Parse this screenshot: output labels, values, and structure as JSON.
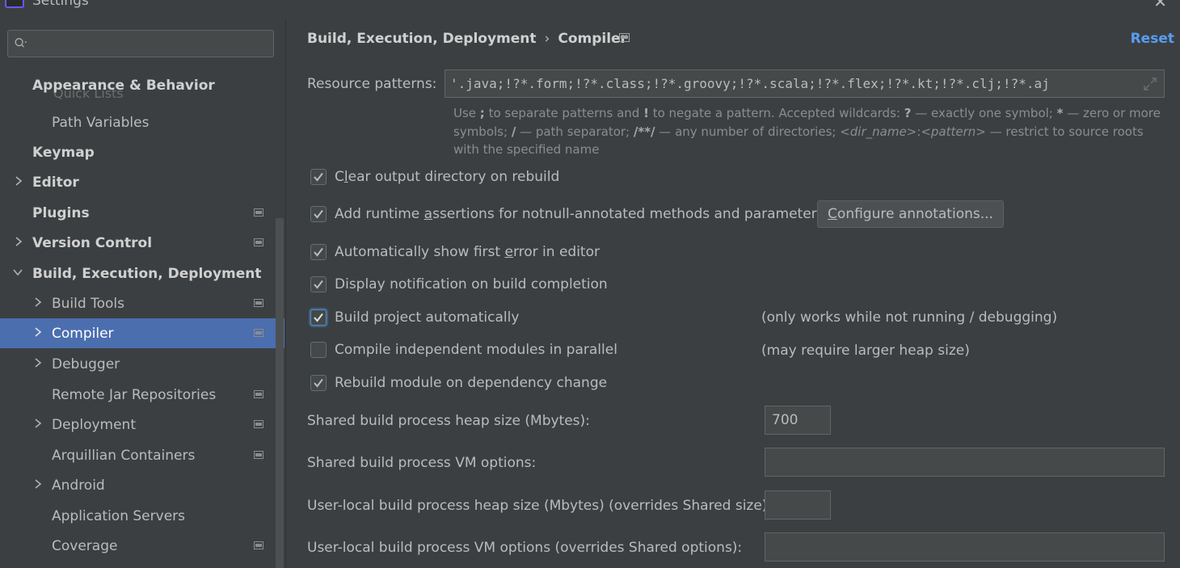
{
  "window": {
    "title": "Settings"
  },
  "search": {
    "placeholder": "",
    "value": ""
  },
  "sidebar": {
    "ghost_item": "Quick Lists",
    "items": [
      {
        "label": "Appearance & Behavior",
        "bold": true
      },
      {
        "label": "Path Variables"
      },
      {
        "label": "Keymap",
        "bold": true
      },
      {
        "label": "Editor",
        "bold": true
      },
      {
        "label": "Plugins",
        "bold": true
      },
      {
        "label": "Version Control",
        "bold": true
      },
      {
        "label": "Build, Execution, Deployment",
        "bold": true
      },
      {
        "label": "Build Tools"
      },
      {
        "label": "Compiler",
        "selected": true
      },
      {
        "label": "Debugger"
      },
      {
        "label": "Remote Jar Repositories"
      },
      {
        "label": "Deployment"
      },
      {
        "label": "Arquillian Containers"
      },
      {
        "label": "Android"
      },
      {
        "label": "Application Servers"
      },
      {
        "label": "Coverage"
      }
    ]
  },
  "breadcrumb": {
    "parent": "Build, Execution, Deployment",
    "separator": "›",
    "current": "Compiler"
  },
  "reset_label": "Reset",
  "resource_patterns": {
    "label": "Resource patterns:",
    "value": "'.java;!?*.form;!?*.class;!?*.groovy;!?*.scala;!?*.flex;!?*.kt;!?*.clj;!?*.aj",
    "hint": {
      "p1": "Use ",
      "semi": ";",
      "p2": " to separate patterns and ",
      "bang": "!",
      "p3": " to negate a pattern. Accepted wildcards: ",
      "q": "?",
      "p4": " — exactly one symbol; ",
      "star": "*",
      "p5": " — zero or more symbols; ",
      "slash": "/",
      "p6": " — path separator; ",
      "dstar": "/**/",
      "p7": " — any number of directories; ",
      "dirname": "<dir_name>",
      "colon": ":",
      "pattern": "<pattern>",
      "p8": " — restrict to source roots with the specified name"
    }
  },
  "options": {
    "clear_output": {
      "pre": "C",
      "u": "l",
      "post": "ear output directory on rebuild",
      "checked": true
    },
    "runtime_assertions": {
      "pre": "Add runtime ",
      "u": "a",
      "post": "ssertions for notnull-annotated methods and parameters",
      "checked": true
    },
    "configure_annotations": {
      "pre": "",
      "u": "C",
      "post": "onfigure annotations..."
    },
    "show_first_error": {
      "pre": "Automatically show first ",
      "u": "e",
      "post": "rror in editor",
      "checked": true
    },
    "display_notification": {
      "label": "Display notification on build completion",
      "checked": true
    },
    "build_automatically": {
      "label": "Build project automatically",
      "checked": true,
      "note": "(only works while not running / debugging)"
    },
    "compile_parallel": {
      "label": "Compile independent modules in parallel",
      "checked": false,
      "note": "(may require larger heap size)"
    },
    "rebuild_on_dependency": {
      "label": "Rebuild module on dependency change",
      "checked": true
    }
  },
  "fields": {
    "shared_heap": {
      "label": "Shared build process heap size (Mbytes):",
      "value": "700"
    },
    "shared_vm": {
      "label": "Shared build process VM options:",
      "value": ""
    },
    "user_heap": {
      "label": "User-local build process heap size (Mbytes) (overrides Shared size):",
      "value": ""
    },
    "user_vm": {
      "label": "User-local build process VM options (overrides Shared options):",
      "value": ""
    }
  },
  "colors": {
    "selection": "#4b6eaf",
    "link": "#589df6",
    "background": "#3c3f41"
  },
  "icons": [
    "app-icon",
    "close-icon",
    "search-icon",
    "chevron-right-icon",
    "chevron-down-icon",
    "page-settings-icon",
    "expand-icon",
    "check-icon"
  ]
}
